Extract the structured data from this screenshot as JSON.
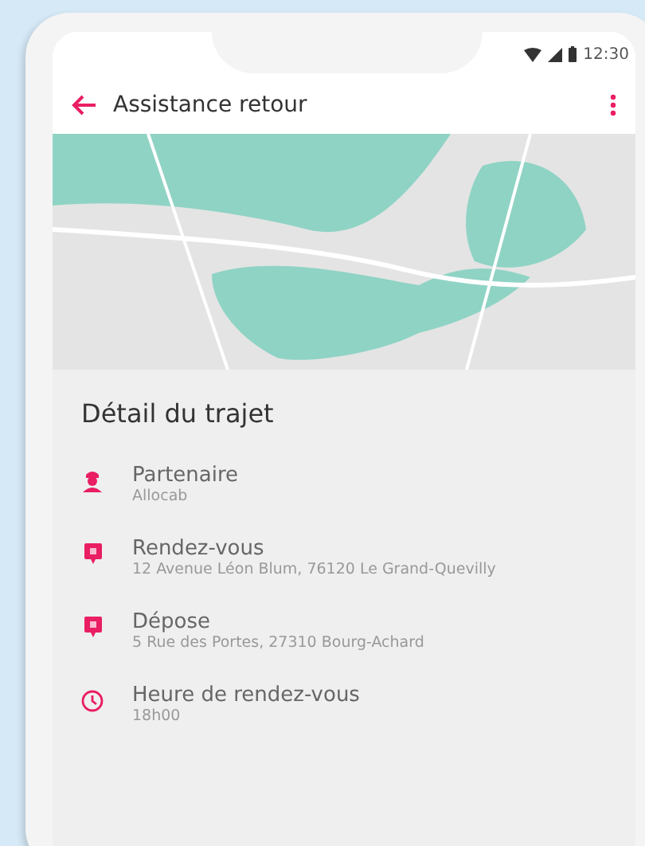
{
  "status_bar": {
    "time": "12:30"
  },
  "app_bar": {
    "title": "Assistance retour"
  },
  "section": {
    "title": "Détail du trajet"
  },
  "items": [
    {
      "kind": "partner",
      "label": "Partenaire",
      "value": "Allocab"
    },
    {
      "kind": "pin",
      "label": "Rendez-vous",
      "value": "12 Avenue Léon Blum, 76120 Le Grand-Quevilly"
    },
    {
      "kind": "pin",
      "label": "Dépose",
      "value": "5 Rue des Portes, 27310 Bourg-Achard"
    },
    {
      "kind": "clock",
      "label": "Heure de rendez-vous",
      "value": "18h00"
    }
  ]
}
